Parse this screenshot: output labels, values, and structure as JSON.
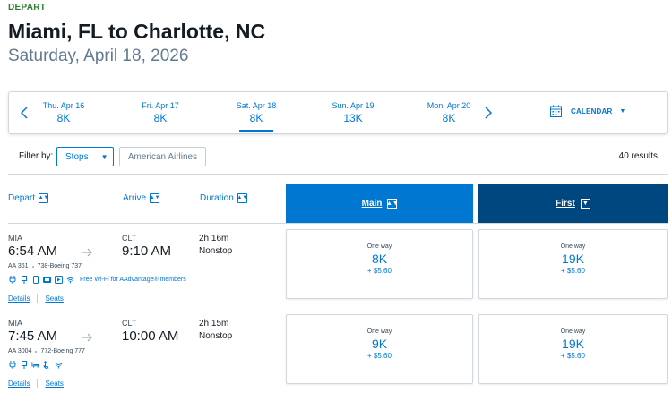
{
  "header": {
    "depart_tag": "DEPART",
    "route_title": "Miami, FL to Charlotte, NC",
    "date": "Saturday, April 18, 2026"
  },
  "date_strip": {
    "items": [
      {
        "label": "Thu. Apr 16",
        "price": "8K"
      },
      {
        "label": "Fri. Apr 17",
        "price": "8K"
      },
      {
        "label": "Sat. Apr 18",
        "price": "8K",
        "selected": true
      },
      {
        "label": "Sun. Apr 19",
        "price": "13K"
      },
      {
        "label": "Mon. Apr 20",
        "price": "8K"
      }
    ],
    "calendar_label": "CALENDAR"
  },
  "filters": {
    "label": "Filter by:",
    "stops_label": "Stops",
    "airline_label": "American Airlines",
    "results_count": "40 results"
  },
  "columns": {
    "depart": "Depart",
    "arrive": "Arrive",
    "duration": "Duration",
    "main": "Main",
    "first": "First"
  },
  "flights": [
    {
      "origin": "MIA",
      "dep_time": "6:54 AM",
      "dest": "CLT",
      "arr_time": "9:10 AM",
      "duration": "2h 16m",
      "stops": "Nonstop",
      "flight_no": "AA 361",
      "aircraft": "738-Boeing 737",
      "wifi_text": "Free Wi-Fi for AAdvantage® members",
      "details_label": "Details",
      "seats_label": "Seats",
      "main": {
        "one_way": "One way",
        "points": "8K",
        "tax": "+ $5.60"
      },
      "first": {
        "one_way": "One way",
        "points": "19K",
        "tax": "+ $5.60"
      }
    },
    {
      "origin": "MIA",
      "dep_time": "7:45 AM",
      "dest": "CLT",
      "arr_time": "10:00 AM",
      "duration": "2h 15m",
      "stops": "Nonstop",
      "flight_no": "AA 3004",
      "aircraft": "772-Boeing 777",
      "details_label": "Details",
      "seats_label": "Seats",
      "main": {
        "one_way": "One way",
        "points": "9K",
        "tax": "+ $5.60"
      },
      "first": {
        "one_way": "One way",
        "points": "19K",
        "tax": "+ $5.60"
      }
    }
  ],
  "colors": {
    "accent": "#0078d2",
    "first_header": "#00467f",
    "depart_tag": "#2e7d32"
  }
}
